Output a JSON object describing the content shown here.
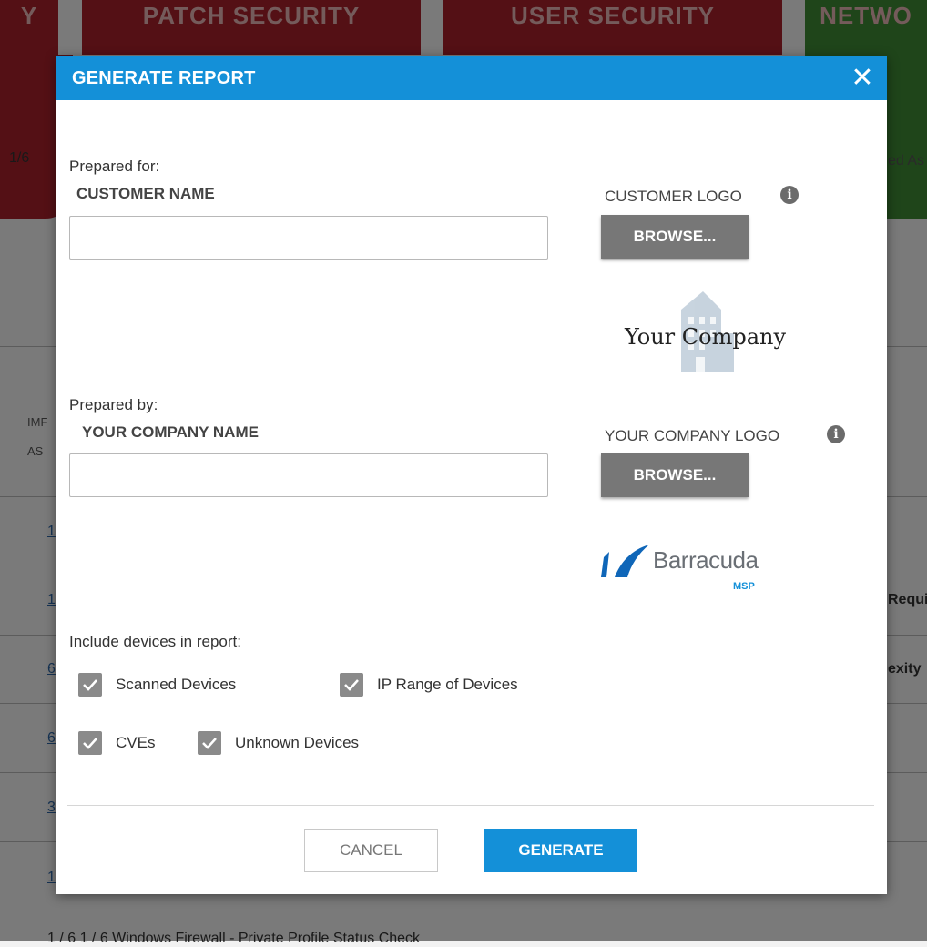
{
  "background": {
    "cards": [
      {
        "label": "Y",
        "color": "#a9212b"
      },
      {
        "label": "PATCH SECURITY",
        "color": "#a9212b"
      },
      {
        "label": "USER SECURITY",
        "color": "#a9212b"
      },
      {
        "label": "NETWO",
        "color": "#3f8a35"
      }
    ],
    "left_fraction": "1/6",
    "right_text": "ed As",
    "col_header_1": "IMF",
    "col_header_2": "AS",
    "row_right_1": "Requi",
    "row_right_2": "exity",
    "row_links": [
      "1",
      "1",
      "6",
      "6",
      "3",
      "1"
    ],
    "bottom_text": "1 / 6                    1 / 6                   Windows Firewall - Private Profile Status Check"
  },
  "modal": {
    "title": "GENERATE REPORT",
    "close_icon": "close-icon",
    "prepared_for_label": "Prepared for:",
    "customer_name_label": "CUSTOMER NAME",
    "customer_name_value": "",
    "customer_logo_label": "CUSTOMER LOGO",
    "browse_label": "BROWSE...",
    "customer_logo_text": "Your Company",
    "prepared_by_label": "Prepared by:",
    "company_name_label": "YOUR COMPANY NAME",
    "company_name_value": "",
    "company_logo_label": "YOUR COMPANY LOGO",
    "company_logo_brand": "Barracuda",
    "company_logo_sub": "MSP",
    "include_label": "Include devices in report:",
    "checkboxes": [
      {
        "label": "Scanned Devices",
        "checked": true
      },
      {
        "label": "IP Range of Devices",
        "checked": true
      },
      {
        "label": "CVEs",
        "checked": true
      },
      {
        "label": "Unknown Devices",
        "checked": true
      }
    ],
    "cancel_label": "CANCEL",
    "generate_label": "GENERATE",
    "accent_color": "#1490d8"
  }
}
